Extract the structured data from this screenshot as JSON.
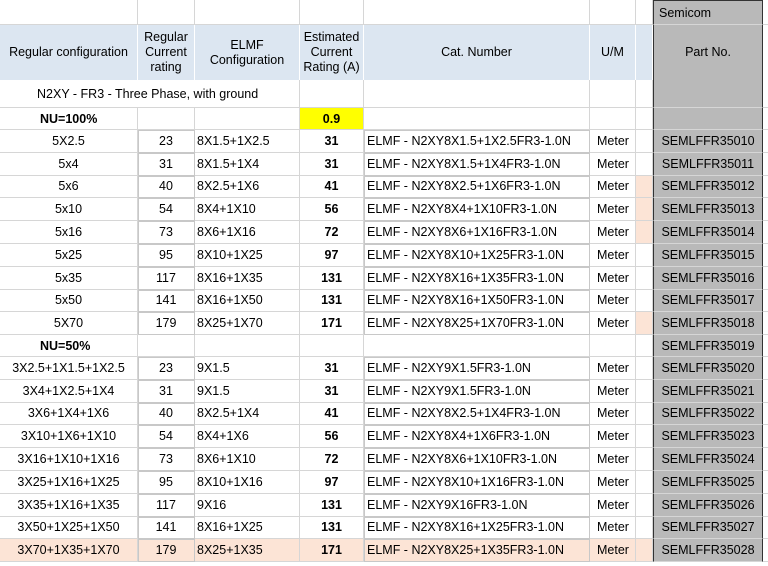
{
  "brand": "Semicom",
  "headers": {
    "regular_configuration": "Regular configuration",
    "regular_current_rating": "Regular Current rating",
    "elmf_configuration": "ELMF Configuration",
    "estimated_current_rating": "Estimated Current Rating (A)",
    "cat_number": "Cat. Number",
    "um": "U/M",
    "part_no": "Part No."
  },
  "section_title": "N2XY - FR3 - Three Phase, with ground",
  "group1": {
    "label": "NU=100%",
    "factor": "0.9",
    "rows": [
      {
        "config": "5X2.5",
        "rating": "23",
        "elmf": "8X1.5+1X2.5",
        "est": "31",
        "cat": "ELMF - N2XY8X1.5+1X2.5FR3-1.0N",
        "um": "Meter",
        "part": "SEMLFFR35010"
      },
      {
        "config": "5x4",
        "rating": "31",
        "elmf": "8X1.5+1X4",
        "est": "31",
        "cat": "ELMF - N2XY8X1.5+1X4FR3-1.0N",
        "um": "Meter",
        "part": "SEMLFFR35011"
      },
      {
        "config": "5x6",
        "rating": "40",
        "elmf": "8X2.5+1X6",
        "est": "41",
        "cat": "ELMF - N2XY8X2.5+1X6FR3-1.0N",
        "um": "Meter",
        "part": "SEMLFFR35012"
      },
      {
        "config": "5x10",
        "rating": "54",
        "elmf": "8X4+1X10",
        "est": "56",
        "cat": "ELMF - N2XY8X4+1X10FR3-1.0N",
        "um": "Meter",
        "part": "SEMLFFR35013"
      },
      {
        "config": "5x16",
        "rating": "73",
        "elmf": "8X6+1X16",
        "est": "72",
        "cat": "ELMF - N2XY8X6+1X16FR3-1.0N",
        "um": "Meter",
        "part": "SEMLFFR35014"
      },
      {
        "config": "5x25",
        "rating": "95",
        "elmf": "8X10+1X25",
        "est": "97",
        "cat": "ELMF - N2XY8X10+1X25FR3-1.0N",
        "um": "Meter",
        "part": "SEMLFFR35015"
      },
      {
        "config": "5x35",
        "rating": "117",
        "elmf": "8X16+1X35",
        "est": "131",
        "cat": "ELMF - N2XY8X16+1X35FR3-1.0N",
        "um": "Meter",
        "part": "SEMLFFR35016"
      },
      {
        "config": "5x50",
        "rating": "141",
        "elmf": "8X16+1X50",
        "est": "131",
        "cat": "ELMF - N2XY8X16+1X50FR3-1.0N",
        "um": "Meter",
        "part": "SEMLFFR35017"
      },
      {
        "config": "5X70",
        "rating": "179",
        "elmf": "8X25+1X70",
        "est": "171",
        "cat": "ELMF - N2XY8X25+1X70FR3-1.0N",
        "um": "Meter",
        "part": "SEMLFFR35018"
      }
    ]
  },
  "group2": {
    "label": "NU=50%",
    "label_part": "SEMLFFR35019",
    "rows": [
      {
        "config": "3X2.5+1X1.5+1X2.5",
        "rating": "23",
        "elmf": "9X1.5",
        "est": "31",
        "cat": "ELMF - N2XY9X1.5FR3-1.0N",
        "um": "Meter",
        "part": "SEMLFFR35020"
      },
      {
        "config": "3X4+1X2.5+1X4",
        "rating": "31",
        "elmf": "9X1.5",
        "est": "31",
        "cat": "ELMF - N2XY9X1.5FR3-1.0N",
        "um": "Meter",
        "part": "SEMLFFR35021"
      },
      {
        "config": "3X6+1X4+1X6",
        "rating": "40",
        "elmf": "8X2.5+1X4",
        "est": "41",
        "cat": "ELMF - N2XY8X2.5+1X4FR3-1.0N",
        "um": "Meter",
        "part": "SEMLFFR35022"
      },
      {
        "config": "3X10+1X6+1X10",
        "rating": "54",
        "elmf": "8X4+1X6",
        "est": "56",
        "cat": "ELMF - N2XY8X4+1X6FR3-1.0N",
        "um": "Meter",
        "part": "SEMLFFR35023"
      },
      {
        "config": "3X16+1X10+1X16",
        "rating": "73",
        "elmf": "8X6+1X10",
        "est": "72",
        "cat": "ELMF - N2XY8X6+1X10FR3-1.0N",
        "um": "Meter",
        "part": "SEMLFFR35024"
      },
      {
        "config": "3X25+1X16+1X25",
        "rating": "95",
        "elmf": "8X10+1X16",
        "est": "97",
        "cat": "ELMF - N2XY8X10+1X16FR3-1.0N",
        "um": "Meter",
        "part": "SEMLFFR35025"
      },
      {
        "config": "3X35+1X16+1X35",
        "rating": "117",
        "elmf": "9X16",
        "est": "131",
        "cat": "ELMF - N2XY9X16FR3-1.0N",
        "um": "Meter",
        "part": "SEMLFFR35026"
      },
      {
        "config": "3X50+1X25+1X50",
        "rating": "141",
        "elmf": "8X16+1X25",
        "est": "131",
        "cat": "ELMF - N2XY8X16+1X25FR3-1.0N",
        "um": "Meter",
        "part": "SEMLFFR35027"
      },
      {
        "config": "3X70+1X35+1X70",
        "rating": "179",
        "elmf": "8X25+1X35",
        "est": "171",
        "cat": "ELMF - N2XY8X25+1X35FR3-1.0N",
        "um": "Meter",
        "part": "SEMLFFR35028"
      }
    ]
  },
  "colors": {
    "header_fill": "#dce6f1",
    "part_column_fill": "#b9b9b9",
    "factor_fill": "#ffff00",
    "marker_fill": "#fce4d6"
  }
}
